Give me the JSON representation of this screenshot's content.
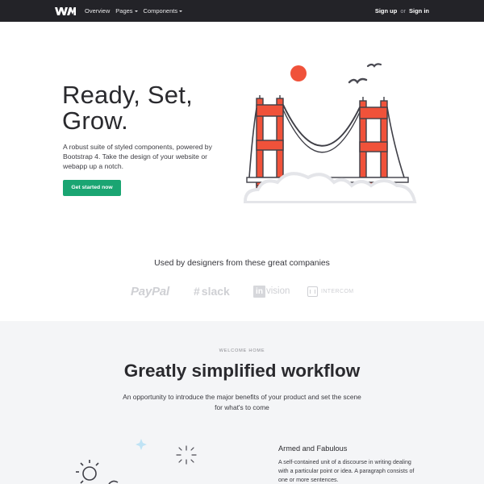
{
  "navbar": {
    "brand_icon": "wm-logo",
    "items": [
      {
        "label": "Overview",
        "dropdown": false
      },
      {
        "label": "Pages",
        "dropdown": true
      },
      {
        "label": "Components",
        "dropdown": true
      }
    ],
    "signup_label": "Sign up",
    "or_label": "or",
    "signin_label": "Sign in"
  },
  "hero": {
    "title_line1": "Ready, Set,",
    "title_line2": "Grow.",
    "description": "A robust suite of styled components, powered by Bootstrap 4. Take the design of your website or webapp up a notch.",
    "cta_label": "Get started now",
    "illustration": "bridge-illustration"
  },
  "trusted": {
    "heading": "Used by designers from these great companies",
    "logos": [
      {
        "name": "PayPal"
      },
      {
        "name": "slack"
      },
      {
        "mark": "in",
        "name": "vision"
      },
      {
        "name": "INTERCOM"
      }
    ]
  },
  "workflow": {
    "eyebrow": "WELCOME HOME",
    "title": "Greatly simplified workflow",
    "description": "An opportunity to introduce the major benefits of your product and set the scene for what's to come",
    "feature": {
      "title": "Armed and Fabulous",
      "body": "A self-contained unit of a discourse in writing dealing with a particular point or idea. A paragraph consists of one or more sentences."
    }
  },
  "colors": {
    "nav_bg": "#232328",
    "accent_green": "#1aa572",
    "bridge_red": "#f0523a",
    "sun_red": "#f0523a",
    "section_bg": "#f4f5f7",
    "logo_gray": "#cfd0d4"
  }
}
